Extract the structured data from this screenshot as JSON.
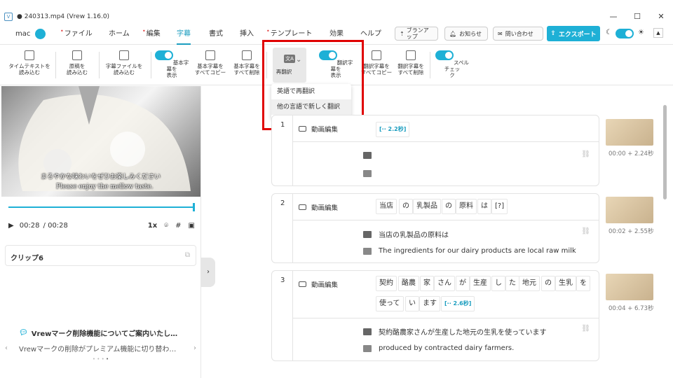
{
  "window": {
    "title": "240313.mp4 (Vrew 1.16.0)",
    "minimize": "—",
    "maximize": "☐",
    "close": "✕"
  },
  "menu": {
    "user": "mac",
    "items": [
      {
        "label": "ファイル",
        "dot": true
      },
      {
        "label": "ホーム",
        "dot": false
      },
      {
        "label": "編集",
        "dot": true
      },
      {
        "label": "字幕",
        "dot": false,
        "active": true
      },
      {
        "label": "書式",
        "dot": false
      },
      {
        "label": "挿入",
        "dot": false
      },
      {
        "label": "テンプレート",
        "dot": true
      },
      {
        "label": "効果",
        "dot": false
      },
      {
        "label": "ヘルプ",
        "dot": false
      }
    ],
    "plan_up": "ブランアップ",
    "news": "お知らせ",
    "contact": "問い合わせ",
    "export": "エクスポート"
  },
  "toolbar": {
    "load_timetext": "タイムテキストを\n読み込む",
    "load_script": "原稿を\n読み込む",
    "load_subfile": "字幕ファイルを\n読み込む",
    "show_basic": "基本字幕を\n表示",
    "copy_basic": "基本字幕を\nすべてコピー",
    "delete_basic": "基本字幕を\nすべて削除",
    "retranslate": "再翻訳",
    "show_trans": "翻訳字幕を\n表示",
    "copy_trans": "翻訳字幕を\nすべてコピー",
    "delete_trans": "翻訳字幕を\nすべて削除",
    "spellcheck": "スペルチェッ\nク"
  },
  "dropdown": [
    "英語で再翻訳",
    "他の言語で新しく翻訳"
  ],
  "player": {
    "subtitle_ja": "まろやかな味わいをぜひお楽しみください",
    "subtitle_en": "Please enjoy the mellow taste.",
    "current": "00:28",
    "total": "/ 00:28",
    "speed": "1x",
    "clip": "クリップ6",
    "notice_title": "Vrewマーク削除機能についてご案内いたし…",
    "notice_body": "Vrewマークの削除がプレミアム機能に切り替わ…"
  },
  "clips": [
    {
      "num": "1",
      "label": "動画編集",
      "chips": [],
      "gap": "[·· 2.2秒]",
      "ja": "",
      "en": "",
      "time": "00:00 + 2.24秒"
    },
    {
      "num": "2",
      "label": "動画編集",
      "chips": [
        "当店",
        "の",
        "乳製品",
        "の",
        "原料",
        "は",
        "[?]"
      ],
      "ja": "当店の乳製品の原料は",
      "en": "The ingredients for our dairy products are local raw milk",
      "time": "00:02 + 2.55秒"
    },
    {
      "num": "3",
      "label": "動画編集",
      "chips": [
        "契約",
        "酪農",
        "家",
        "さん",
        "が",
        "生産",
        "し",
        "た",
        "地元",
        "の",
        "生乳",
        "を",
        "使って",
        "い",
        "ます"
      ],
      "gap": "[·· 2.6秒]",
      "ja": "契約酪農家さんが生産した地元の生乳を使っています",
      "en": "produced by contracted dairy farmers.",
      "time": "00:04 + 6.73秒"
    }
  ]
}
